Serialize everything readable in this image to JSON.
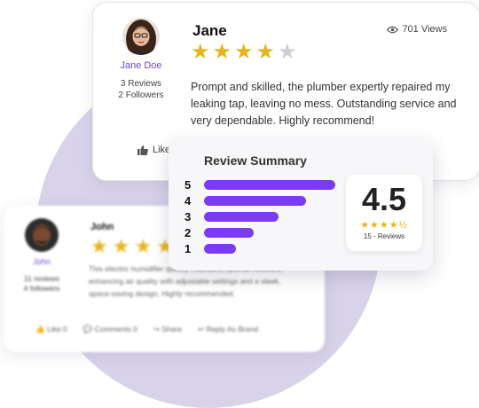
{
  "jane_card": {
    "reviewer_name": "Jane Doe",
    "reviews": "3 Reviews",
    "followers": "2 Followers",
    "title": "Jane",
    "rating": 4,
    "max_rating": 5,
    "views": "701 Views",
    "review_text": "Prompt and skilled, the plumber expertly repaired my leaking tap, leaving no mess. Outstanding service and very dependable. Highly recommend!",
    "like_label": "Like"
  },
  "john_card": {
    "reviewer_name": "John",
    "reviews": "11 reviews",
    "followers": "4 followers",
    "title": "John",
    "rating": 5,
    "review_text": "This electric humidifier quickly maintains optimal moisture, enhancing air quality with adjustable settings and a sleek, space-saving design. Highly recommended.",
    "actions": {
      "like": "Like 0",
      "comments": "Comments 0",
      "share": "Share",
      "reply": "Reply As Brand"
    }
  },
  "summary": {
    "title": "Review Summary",
    "rows": [
      {
        "label": "5",
        "share": 1.0
      },
      {
        "label": "4",
        "share": 0.78
      },
      {
        "label": "3",
        "share": 0.57
      },
      {
        "label": "2",
        "share": 0.38
      },
      {
        "label": "1",
        "share": 0.24
      }
    ],
    "average": "4.5",
    "stars": "★★★★½",
    "count": "15 - Reviews"
  },
  "colors": {
    "accent": "#7a3cf0",
    "star": "#e7b41b",
    "name_link": "#6a47d9",
    "blob": "#d9d3ea"
  }
}
